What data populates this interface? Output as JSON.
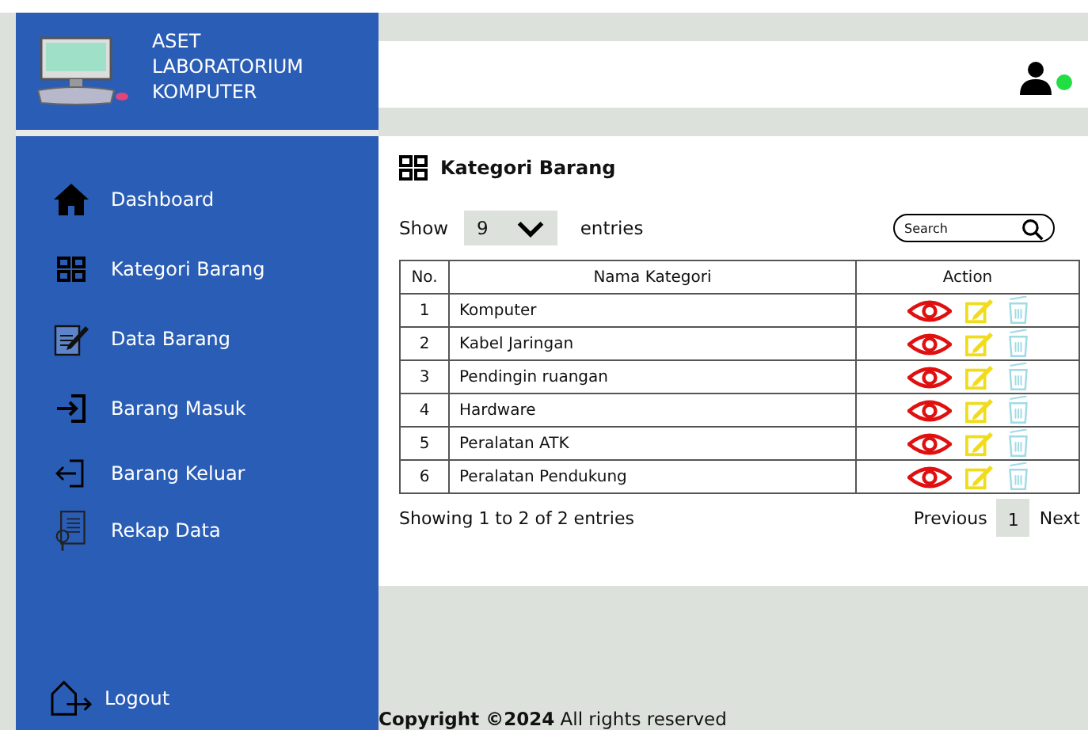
{
  "sidebar": {
    "brand_lines": [
      "ASET",
      "LABORATORIUM",
      "KOMPUTER"
    ],
    "items": [
      {
        "label": "Dashboard",
        "kind": "home"
      },
      {
        "label": "Kategori Barang",
        "kind": "grid"
      },
      {
        "label": "Data Barang",
        "kind": "document"
      },
      {
        "label": "Barang Masuk",
        "kind": "enter"
      },
      {
        "label": "Barang Keluar",
        "kind": "exit"
      },
      {
        "label": "Rekap Data",
        "kind": "report"
      }
    ],
    "logout": {
      "label": "Logout"
    }
  },
  "header": {
    "user_online": true
  },
  "page": {
    "title": "Kategori Barang",
    "show_label": "Show",
    "entries_value": "9",
    "entries_label": "entries",
    "search": {
      "placeholder": "Search"
    },
    "table": {
      "columns": [
        "No.",
        "Nama Kategori",
        "Action"
      ],
      "rows": [
        {
          "no": "1",
          "name": "Komputer"
        },
        {
          "no": "2",
          "name": "Kabel Jaringan"
        },
        {
          "no": "3",
          "name": "Pendingin ruangan"
        },
        {
          "no": "4",
          "name": "Hardware"
        },
        {
          "no": "5",
          "name": "Peralatan ATK"
        },
        {
          "no": "6",
          "name": "Peralatan Pendukung"
        }
      ]
    },
    "info": "Showing 1 to 2 of 2 entries",
    "pagination": {
      "previous": "Previous",
      "pages": [
        {
          "label": "1",
          "selected": true
        }
      ],
      "next": "Next"
    }
  },
  "footer": {
    "copyright": "**Copyright ©2024** All rights reserved"
  }
}
